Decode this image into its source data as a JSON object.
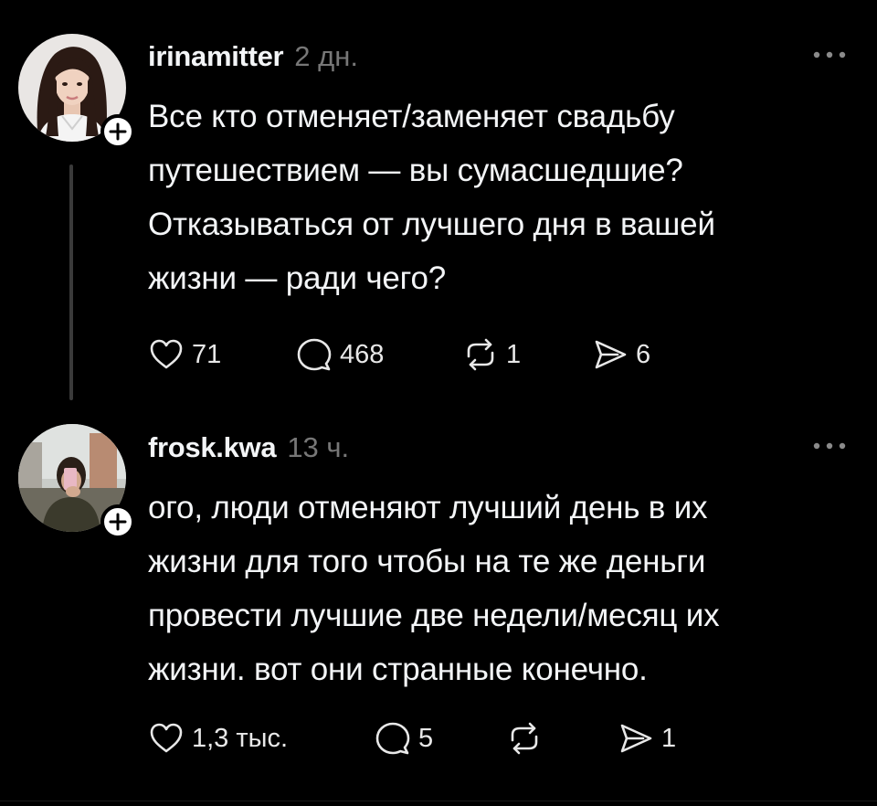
{
  "posts": [
    {
      "username": "irinamitter",
      "time": "2 дн.",
      "lines": [
        "Все кто отменяет/заменяет свадьбу",
        "путешествием — вы сумасшедшие?",
        "Отказываться от лучшего дня в вашей",
        "жизни — ради чего?"
      ],
      "likes": "71",
      "comments": "468",
      "reposts": "1",
      "shares": "6"
    },
    {
      "username": "frosk.kwa",
      "time": "13 ч.",
      "lines": [
        "ого, люди отменяют лучший день в их",
        "жизни для того чтобы на те же деньги",
        "провести лучшие две недели/месяц их",
        "жизни. вот они странные конечно."
      ],
      "likes": "1,3 тыс.",
      "comments": "5",
      "reposts": "",
      "shares": "1"
    }
  ],
  "icons": {
    "like": "heart-icon",
    "comment": "comment-bubble-icon",
    "repost": "repost-icon",
    "share": "send-icon",
    "more": "more-dots-icon",
    "follow": "plus-icon"
  },
  "colors": {
    "background": "#000000",
    "text": "#f3f5f7",
    "muted": "#777777",
    "thread": "#3a3a3a"
  }
}
